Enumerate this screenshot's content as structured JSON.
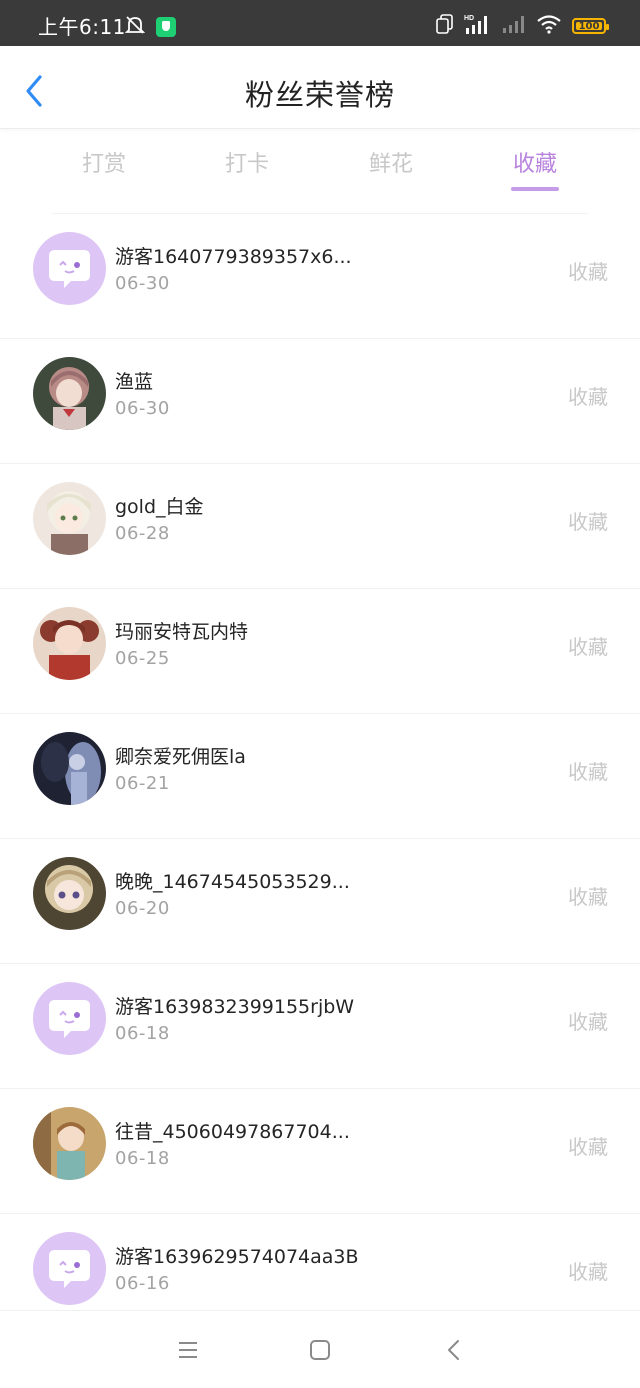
{
  "status_bar": {
    "time": "上午6:11",
    "battery": "100",
    "signal_label": "HD",
    "icons": [
      "bell-off-icon",
      "shield-app-icon",
      "dual-sim-icon",
      "signal-hd-icon",
      "signal-empty-icon",
      "wifi-icon",
      "battery-icon"
    ]
  },
  "header": {
    "title": "粉丝荣誉榜",
    "back_icon": "chevron-left-icon",
    "back_color": "#2f8cf6"
  },
  "tabs": [
    {
      "label": "打赏",
      "active": false
    },
    {
      "label": "打卡",
      "active": false
    },
    {
      "label": "鲜花",
      "active": false
    },
    {
      "label": "收藏",
      "active": true
    }
  ],
  "accent_color": "#b883dd",
  "list": [
    {
      "name": "游客1640779389357x6...",
      "date": "06-30",
      "action": "收藏",
      "avatar": "default-chat-avatar"
    },
    {
      "name": "渔蓝",
      "date": "06-30",
      "action": "收藏",
      "avatar": "anime-girl-avatar"
    },
    {
      "name": "gold_白金",
      "date": "06-28",
      "action": "收藏",
      "avatar": "anime-boy-avatar"
    },
    {
      "name": "玛丽安特瓦内特",
      "date": "06-25",
      "action": "收藏",
      "avatar": "anime-girl-avatar"
    },
    {
      "name": "卿奈爱死佣医la",
      "date": "06-21",
      "action": "收藏",
      "avatar": "dark-art-avatar"
    },
    {
      "name": "晚晚_14674545053529...",
      "date": "06-20",
      "action": "收藏",
      "avatar": "anime-girl-avatar"
    },
    {
      "name": "游客1639832399155rjbW",
      "date": "06-18",
      "action": "收藏",
      "avatar": "default-chat-avatar"
    },
    {
      "name": "往昔_45060497867704...",
      "date": "06-18",
      "action": "收藏",
      "avatar": "anime-girl-avatar"
    },
    {
      "name": "游客1639629574074aa3B",
      "date": "06-16",
      "action": "收藏",
      "avatar": "default-chat-avatar"
    }
  ],
  "nav_bar": {
    "icons": [
      "menu-icon",
      "home-square-icon",
      "back-triangle-icon"
    ]
  }
}
